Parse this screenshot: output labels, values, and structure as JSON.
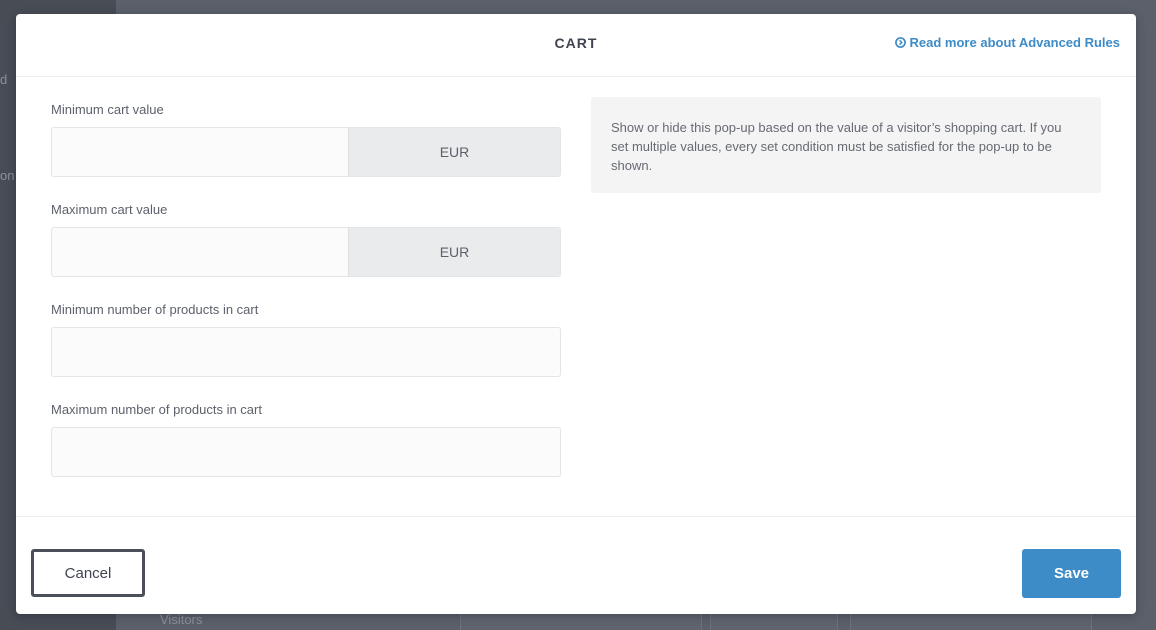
{
  "background": {
    "sidebar_fragments": [
      "d",
      "on"
    ],
    "bottom_text": "Visitors"
  },
  "modal": {
    "title": "CART",
    "read_more_link": "Read more about Advanced Rules",
    "fields": {
      "min_cart_value": {
        "label": "Minimum cart value",
        "value": "",
        "currency": "EUR"
      },
      "max_cart_value": {
        "label": "Maximum cart value",
        "value": "",
        "currency": "EUR"
      },
      "min_products": {
        "label": "Minimum number of products in cart",
        "value": ""
      },
      "max_products": {
        "label": "Maximum number of products in cart",
        "value": ""
      }
    },
    "info_text": "Show or hide this pop-up based on the value of a visitor’s shopping cart. If you set multiple values, every set condition must be satisfied for the pop-up to be shown.",
    "buttons": {
      "cancel": "Cancel",
      "save": "Save"
    }
  },
  "colors": {
    "accent": "#3d8bc7",
    "overlay": "#5b606a"
  },
  "icons": {
    "read_more": "arrow-right-circle-icon"
  }
}
